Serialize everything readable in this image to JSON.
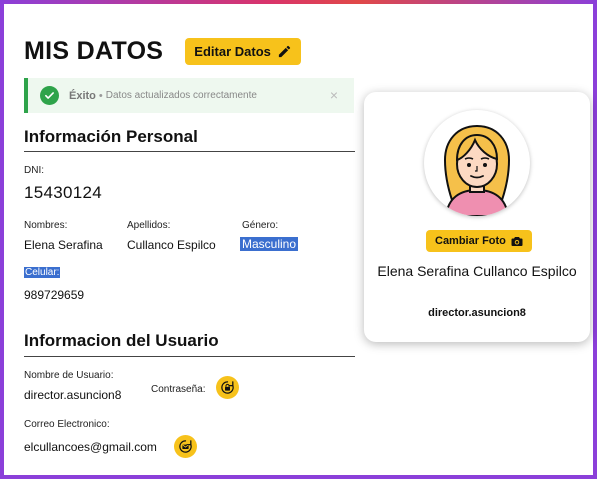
{
  "header": {
    "title": "MIS DATOS",
    "edit_button": "Editar Datos"
  },
  "alert": {
    "title": "Éxito",
    "separator": "•",
    "message": "Datos actualizados correctamente",
    "close": "×"
  },
  "personal": {
    "section_title": "Información Personal",
    "dni_label": "DNI:",
    "dni_value": "15430124",
    "names_label": "Nombres:",
    "names_value": "Elena Serafina",
    "surnames_label": "Apellidos:",
    "surnames_value": "Cullanco Espilco",
    "gender_label": "Género:",
    "gender_value": "Masculino",
    "phone_label": "Celular:",
    "phone_value": "989729659"
  },
  "user": {
    "section_title": "Informacion del Usuario",
    "username_label": "Nombre de Usuario:",
    "username_value": "director.asuncion8",
    "password_label": "Contraseña:",
    "email_label": "Correo Electronico:",
    "email_value": "elcullancoes@gmail.com"
  },
  "profile_card": {
    "photo_button": "Cambiar Foto",
    "full_name": "Elena Serafina Cullanco Espilco",
    "username": "director.asuncion8"
  },
  "colors": {
    "accent_yellow": "#f7c21b",
    "success_green": "#2ea34a",
    "frame_purple": "#8b3fd9",
    "selection_blue": "#3b6fcf"
  },
  "icons": [
    "pencil-icon",
    "check-circle-icon",
    "close-icon",
    "camera-icon",
    "lock-reset-icon",
    "email-reset-icon"
  ]
}
